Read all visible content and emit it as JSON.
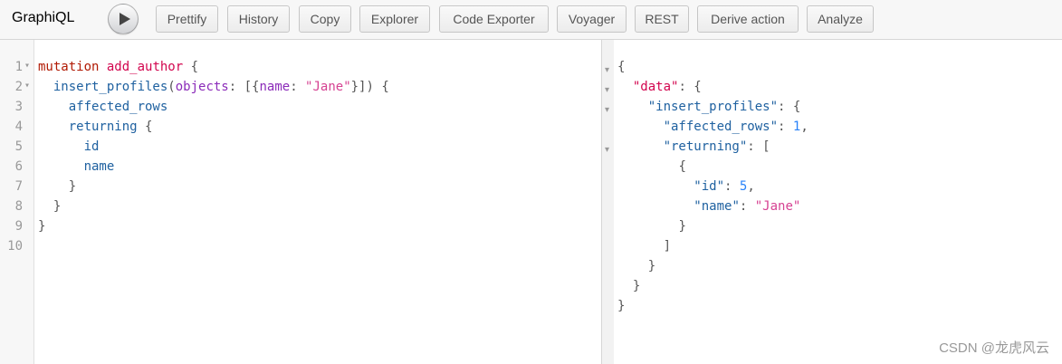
{
  "app": {
    "title": "GraphiQL"
  },
  "toolbar": {
    "buttons": [
      "Prettify",
      "History",
      "Copy",
      "Explorer",
      "Code Exporter",
      "Voyager",
      "REST",
      "Derive action",
      "Analyze"
    ]
  },
  "query": {
    "line_numbers": [
      "1",
      "2",
      "3",
      "4",
      "5",
      "6",
      "7",
      "8",
      "9",
      "10"
    ],
    "l1": {
      "kw": "mutation",
      "name": "add_author",
      "brace": "{"
    },
    "l2": {
      "field": "insert_profiles",
      "p1": "(",
      "arg": "objects",
      "p2": ": [{",
      "arg2": "name",
      "p3": ": ",
      "value": "\"Jane\"",
      "p4": "}]) {"
    },
    "l3": {
      "field": "affected_rows"
    },
    "l4": {
      "field": "returning",
      "brace": "{"
    },
    "l5": {
      "field": "id"
    },
    "l6": {
      "field": "name"
    },
    "l7": {
      "brace": "}"
    },
    "l8": {
      "brace": "}"
    },
    "l9": {
      "brace": "}"
    }
  },
  "response": {
    "r1": "{",
    "r2": {
      "key": "\"data\"",
      "rest": ": {"
    },
    "r3": {
      "key": "\"insert_profiles\"",
      "rest": ": {"
    },
    "r4": {
      "key": "\"affected_rows\"",
      "sep": ": ",
      "value": "1",
      "end": ","
    },
    "r5": {
      "key": "\"returning\"",
      "rest": ": ["
    },
    "r6": "{",
    "r7": {
      "key": "\"id\"",
      "sep": ": ",
      "value": "5",
      "end": ","
    },
    "r8": {
      "key": "\"name\"",
      "sep": ": ",
      "value": "\"Jane\""
    },
    "r9": "}",
    "r10": "]",
    "r11": "}",
    "r12": "}",
    "r13": "}"
  },
  "watermark": "CSDN @龙虎风云"
}
